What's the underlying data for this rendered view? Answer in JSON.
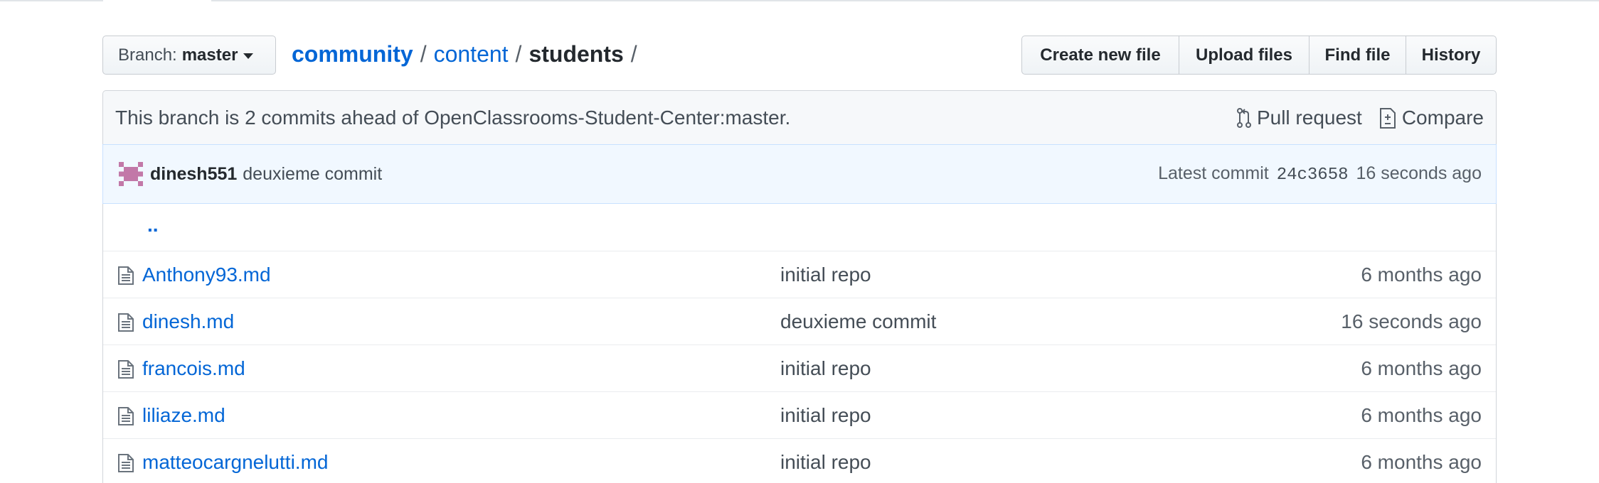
{
  "branch": {
    "label": "Branch:",
    "value": "master"
  },
  "breadcrumb": {
    "repo": "community",
    "sep1": "/",
    "folder": "content",
    "sep2": "/",
    "current": "students",
    "sep3": "/"
  },
  "actions": {
    "create_new_file": "Create new file",
    "upload_files": "Upload files",
    "find_file": "Find file",
    "history": "History"
  },
  "tracking": {
    "message": "This branch is 2 commits ahead of OpenClassrooms-Student-Center:master.",
    "pull_request": "Pull request",
    "compare": "Compare"
  },
  "commit": {
    "author": "dinesh551",
    "message": "deuxieme commit",
    "latest_label": "Latest commit",
    "sha": "24c3658",
    "age": "16 seconds ago"
  },
  "parent_link": "..",
  "files": [
    {
      "name": "Anthony93.md",
      "message": "initial repo",
      "age": "6 months ago"
    },
    {
      "name": "dinesh.md",
      "message": "deuxieme commit",
      "age": "16 seconds ago"
    },
    {
      "name": "francois.md",
      "message": "initial repo",
      "age": "6 months ago"
    },
    {
      "name": "liliaze.md",
      "message": "initial repo",
      "age": "6 months ago"
    },
    {
      "name": "matteocargnelutti.md",
      "message": "initial repo",
      "age": "6 months ago"
    }
  ],
  "colors": {
    "link": "#0366d6",
    "avatar": "#c278a8",
    "commit_bar_bg": "#f1f8ff",
    "tracking_bg": "#f6f8fa"
  },
  "icons": {
    "file": "file-icon",
    "pull_request": "git-pull-request-icon",
    "compare": "diff-icon",
    "caret": "caret-down-icon"
  }
}
